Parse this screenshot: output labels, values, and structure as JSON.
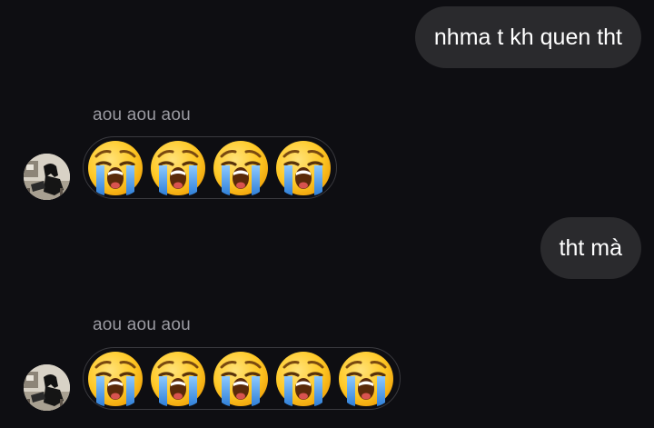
{
  "messages": [
    {
      "direction": "outgoing",
      "text": "nhma t kh quen tht"
    },
    {
      "direction": "incoming",
      "sender": "aou aou aou",
      "emojis": [
        "loudly-crying-face-icon",
        "loudly-crying-face-icon",
        "loudly-crying-face-icon",
        "loudly-crying-face-icon"
      ]
    },
    {
      "direction": "outgoing",
      "text": "tht mà"
    },
    {
      "direction": "incoming",
      "sender": "aou aou aou",
      "emojis": [
        "loudly-crying-face-icon",
        "loudly-crying-face-icon",
        "loudly-crying-face-icon",
        "loudly-crying-face-icon",
        "loudly-crying-face-icon"
      ]
    }
  ],
  "colors": {
    "background": "#0e0e12",
    "outgoing_bubble": "#2a2a2d",
    "sender_name": "#9a9aa1",
    "emoji_face": "#ffca28",
    "emoji_tears": "#4a9ee8"
  }
}
